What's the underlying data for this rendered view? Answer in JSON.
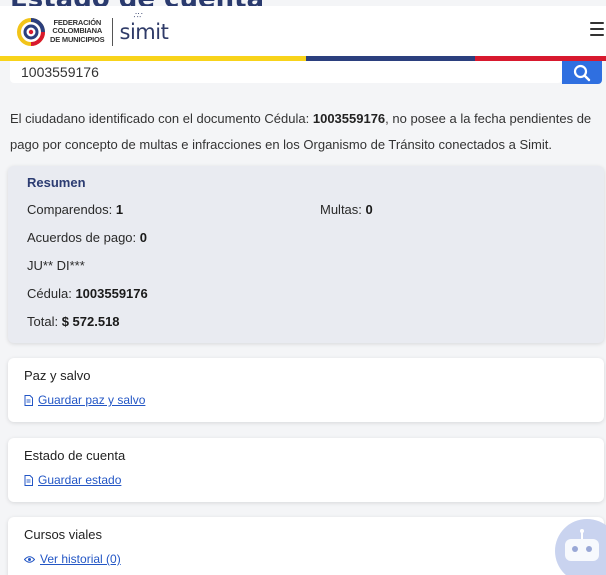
{
  "page": {
    "title": "Estado de cuenta"
  },
  "header": {
    "org_name_line1": "FEDERACIÓN",
    "org_name_line2": "COLOMBIANA",
    "org_name_line3": "DE MUNICIPIOS",
    "brand": "simit"
  },
  "search": {
    "value": "1003559176"
  },
  "info": {
    "prefix": "El ciudadano identificado con el documento",
    "doc_type": "Cédula:",
    "doc_number": "1003559176",
    "suffix": ", no posee a la fecha pendientes de pago por concepto de multas e infracciones en los Organismo de Tránsito conectados a Simit."
  },
  "summary": {
    "title": "Resumen",
    "comparendos_label": "Comparendos:",
    "comparendos_value": "1",
    "multas_label": "Multas:",
    "multas_value": "0",
    "acuerdos_label": "Acuerdos de pago:",
    "acuerdos_value": "0",
    "name": "JU** DI***",
    "cedula_label": "Cédula:",
    "cedula_value": "1003559176",
    "total_label": "Total:",
    "total_value": "$ 572.518"
  },
  "cards": {
    "paz": {
      "title": "Paz y salvo",
      "link": "Guardar paz y salvo",
      "icon": "document-icon"
    },
    "estado": {
      "title": "Estado de cuenta",
      "link": "Guardar estado",
      "icon": "document-icon"
    },
    "cursos": {
      "title": "Cursos viales",
      "link": "Ver historial (0)",
      "icon": "eye-icon"
    }
  },
  "colors": {
    "accent": "#2f6fe0",
    "stripe_yellow": "#f8d31a",
    "stripe_blue": "#2b3f7e",
    "stripe_red": "#d8192e"
  }
}
